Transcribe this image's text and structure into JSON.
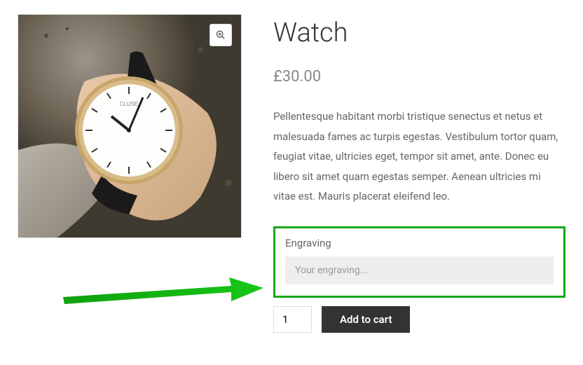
{
  "product": {
    "title": "Watch",
    "price": "£30.00",
    "description": "Pellentesque habitant morbi tristique senectus et netus et malesuada fames ac turpis egestas. Vestibulum tortor quam, feugiat vitae, ultricies eget, tempor sit amet, ante. Donec eu libero sit amet quam egestas semper. Aenean ultricies mi vitae est. Mauris placerat eleifend leo."
  },
  "engraving": {
    "label": "Engraving",
    "placeholder": "Your engraving..."
  },
  "cart": {
    "quantity": "1",
    "add_label": "Add to cart"
  }
}
